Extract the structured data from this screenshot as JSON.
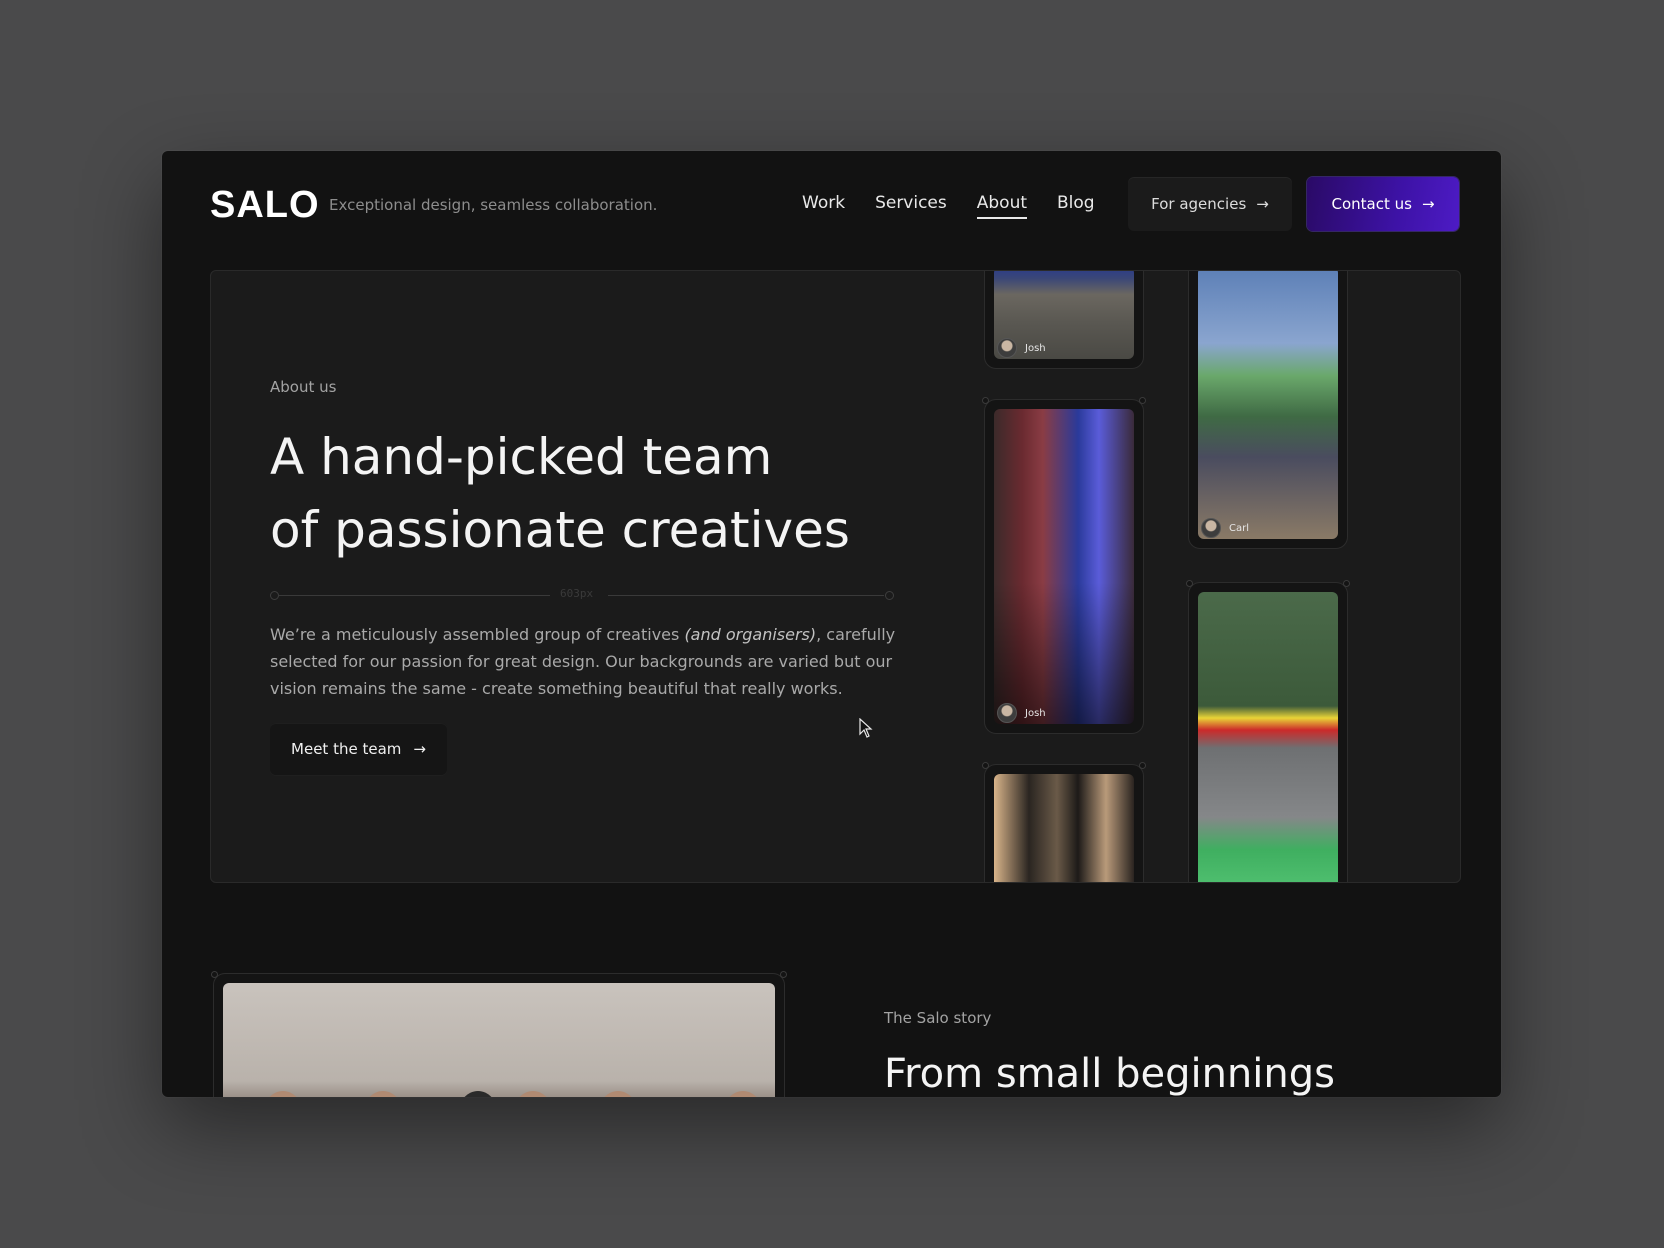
{
  "header": {
    "logo": "SALO",
    "tagline": "Exceptional design, seamless collaboration.",
    "nav": [
      {
        "label": "Work",
        "active": false
      },
      {
        "label": "Services",
        "active": false
      },
      {
        "label": "About",
        "active": true
      },
      {
        "label": "Blog",
        "active": false
      }
    ],
    "agencies_label": "For agencies",
    "contact_label": "Contact us"
  },
  "hero": {
    "eyebrow": "About us",
    "title_line1": "A hand-picked team",
    "title_line2": "of passionate creatives",
    "ruler_label": "603px",
    "body_part1": "We’re a meticulously assembled group of creatives ",
    "body_emphasis": "(and organisers)",
    "body_part2": ", carefully selected for our passion for great design. Our backgrounds are varied but our vision remains the same - create something beautiful that really works.",
    "cta_label": "Meet the team"
  },
  "photos": {
    "crowd": {
      "name": "Josh"
    },
    "arcade": {
      "name": "Josh"
    },
    "podium": {
      "name": "Carl"
    }
  },
  "story": {
    "eyebrow": "The Salo story",
    "title": "From small beginnings"
  },
  "colors": {
    "page_bg": "#4a4a4b",
    "window_bg": "#121212",
    "card_bg": "#1b1b1b",
    "accent_purple": "#3d12a6"
  }
}
